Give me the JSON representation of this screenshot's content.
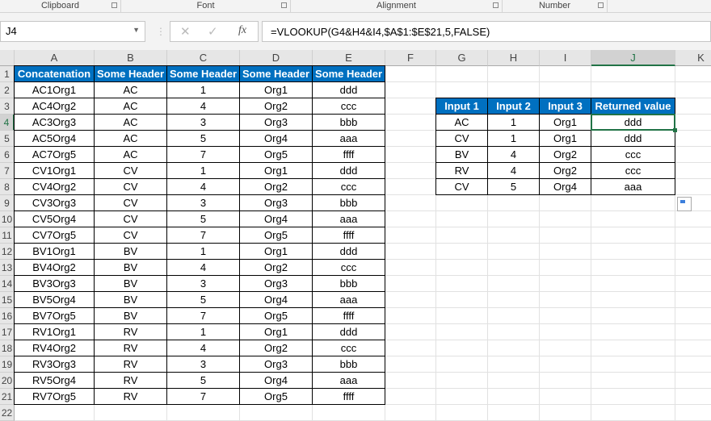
{
  "ribbon": {
    "groups": [
      "Clipboard",
      "Font",
      "Alignment",
      "Number"
    ]
  },
  "formula_bar": {
    "name_box": "J4",
    "formula": "=VLOOKUP(G4&H4&I4,$A$1:$E$21,5,FALSE)",
    "cancel_icon": "✕",
    "enter_icon": "✓",
    "fx_label": "fx"
  },
  "columns": [
    "A",
    "B",
    "C",
    "D",
    "E",
    "F",
    "G",
    "H",
    "I",
    "J",
    "K"
  ],
  "selected_cell": "J4",
  "main_table": {
    "headers": [
      "Concatenation",
      "Some Header",
      "Some Header",
      "Some Header",
      "Some Header"
    ],
    "rows": [
      [
        "AC1Org1",
        "AC",
        "1",
        "Org1",
        "ddd"
      ],
      [
        "AC4Org2",
        "AC",
        "4",
        "Org2",
        "ccc"
      ],
      [
        "AC3Org3",
        "AC",
        "3",
        "Org3",
        "bbb"
      ],
      [
        "AC5Org4",
        "AC",
        "5",
        "Org4",
        "aaa"
      ],
      [
        "AC7Org5",
        "AC",
        "7",
        "Org5",
        "ffff"
      ],
      [
        "CV1Org1",
        "CV",
        "1",
        "Org1",
        "ddd"
      ],
      [
        "CV4Org2",
        "CV",
        "4",
        "Org2",
        "ccc"
      ],
      [
        "CV3Org3",
        "CV",
        "3",
        "Org3",
        "bbb"
      ],
      [
        "CV5Org4",
        "CV",
        "5",
        "Org4",
        "aaa"
      ],
      [
        "CV7Org5",
        "CV",
        "7",
        "Org5",
        "ffff"
      ],
      [
        "BV1Org1",
        "BV",
        "1",
        "Org1",
        "ddd"
      ],
      [
        "BV4Org2",
        "BV",
        "4",
        "Org2",
        "ccc"
      ],
      [
        "BV3Org3",
        "BV",
        "3",
        "Org3",
        "bbb"
      ],
      [
        "BV5Org4",
        "BV",
        "5",
        "Org4",
        "aaa"
      ],
      [
        "BV7Org5",
        "BV",
        "7",
        "Org5",
        "ffff"
      ],
      [
        "RV1Org1",
        "RV",
        "1",
        "Org1",
        "ddd"
      ],
      [
        "RV4Org2",
        "RV",
        "4",
        "Org2",
        "ccc"
      ],
      [
        "RV3Org3",
        "RV",
        "3",
        "Org3",
        "bbb"
      ],
      [
        "RV5Org4",
        "RV",
        "5",
        "Org4",
        "aaa"
      ],
      [
        "RV7Org5",
        "RV",
        "7",
        "Org5",
        "ffff"
      ]
    ]
  },
  "lookup_table": {
    "headers": [
      "Input 1",
      "Input 2",
      "Input 3",
      "Returned value"
    ],
    "rows": [
      [
        "AC",
        "1",
        "Org1",
        "ddd"
      ],
      [
        "CV",
        "1",
        "Org1",
        "ddd"
      ],
      [
        "BV",
        "4",
        "Org2",
        "ccc"
      ],
      [
        "RV",
        "4",
        "Org2",
        "ccc"
      ],
      [
        "CV",
        "5",
        "Org4",
        "aaa"
      ]
    ]
  },
  "colors": {
    "header_fill": "#0070c0",
    "selection": "#217346"
  }
}
